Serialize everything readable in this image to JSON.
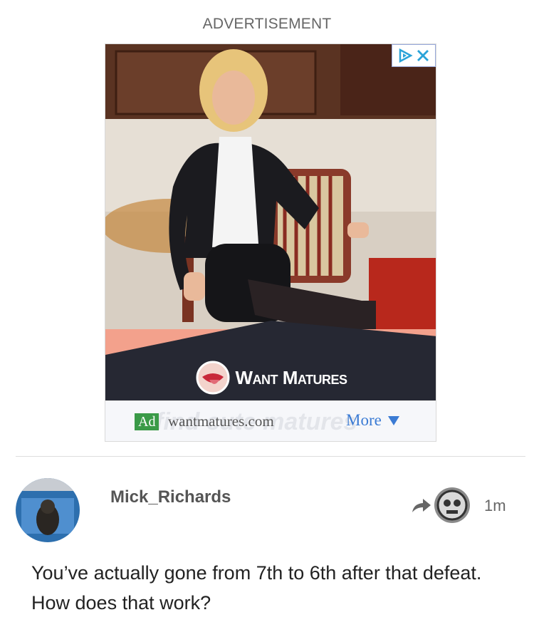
{
  "advertisement": {
    "label": "ADVERTISEMENT",
    "brand_name": "Want Matures",
    "ghost_text": "find cute matures",
    "badge": "Ad",
    "domain": "wantmatures.com",
    "more_label": "More",
    "colors": {
      "banner_dark": "#262833",
      "banner_salmon": "#f3a18c",
      "badge_green": "#3a9a47",
      "link_blue": "#3b7bd4"
    },
    "icons": [
      "adchoices-icon",
      "close-icon",
      "brand-logo-icon",
      "triangle-down-icon"
    ]
  },
  "comment": {
    "username": "Mick_Richards",
    "timestamp": "1m",
    "text": "You’ve actually gone from 7th to 6th after that defeat. How does that work?",
    "icons": [
      "avatar",
      "reply-arrow-icon",
      "reply-to-avatar"
    ]
  }
}
